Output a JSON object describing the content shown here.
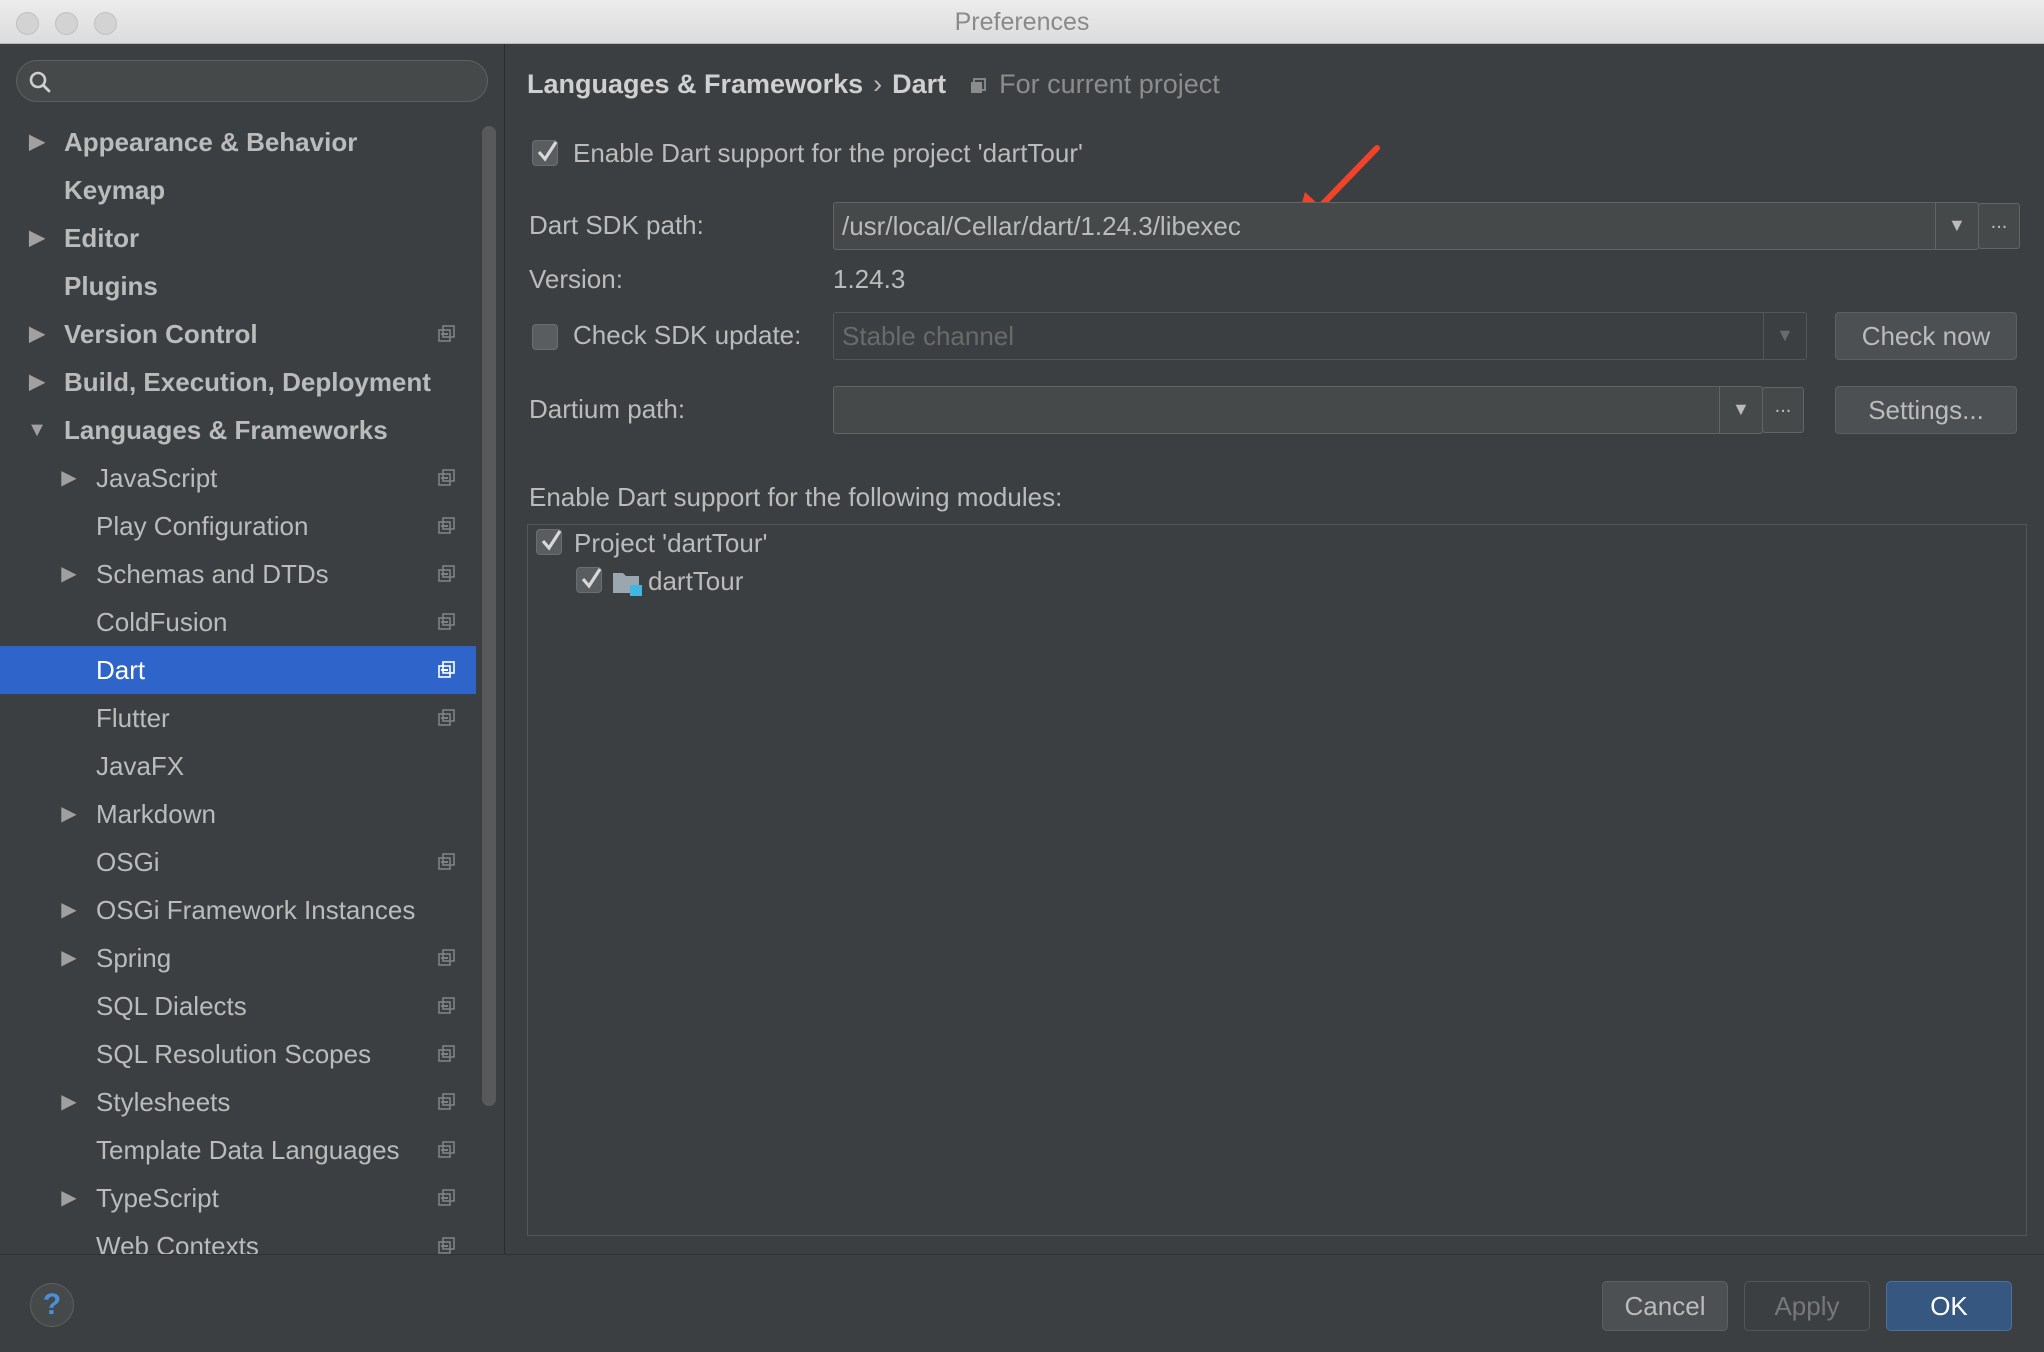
{
  "window": {
    "title": "Preferences"
  },
  "search": {
    "placeholder": ""
  },
  "sidebar": {
    "items": [
      {
        "label": "Appearance & Behavior",
        "bold": true,
        "level": 0,
        "arrow": "right",
        "project": false
      },
      {
        "label": "Keymap",
        "bold": true,
        "level": 0,
        "arrow": "",
        "project": false
      },
      {
        "label": "Editor",
        "bold": true,
        "level": 0,
        "arrow": "right",
        "project": false
      },
      {
        "label": "Plugins",
        "bold": true,
        "level": 0,
        "arrow": "",
        "project": false
      },
      {
        "label": "Version Control",
        "bold": true,
        "level": 0,
        "arrow": "right",
        "project": true
      },
      {
        "label": "Build, Execution, Deployment",
        "bold": true,
        "level": 0,
        "arrow": "right",
        "project": false
      },
      {
        "label": "Languages & Frameworks",
        "bold": true,
        "level": 0,
        "arrow": "down",
        "project": false
      },
      {
        "label": "JavaScript",
        "bold": false,
        "level": 1,
        "arrow": "right",
        "project": true
      },
      {
        "label": "Play Configuration",
        "bold": false,
        "level": 1,
        "arrow": "",
        "project": true
      },
      {
        "label": "Schemas and DTDs",
        "bold": false,
        "level": 1,
        "arrow": "right",
        "project": true
      },
      {
        "label": "ColdFusion",
        "bold": false,
        "level": 1,
        "arrow": "",
        "project": true
      },
      {
        "label": "Dart",
        "bold": false,
        "level": 1,
        "arrow": "",
        "project": true,
        "selected": true
      },
      {
        "label": "Flutter",
        "bold": false,
        "level": 1,
        "arrow": "",
        "project": true
      },
      {
        "label": "JavaFX",
        "bold": false,
        "level": 1,
        "arrow": "",
        "project": false
      },
      {
        "label": "Markdown",
        "bold": false,
        "level": 1,
        "arrow": "right",
        "project": false
      },
      {
        "label": "OSGi",
        "bold": false,
        "level": 1,
        "arrow": "",
        "project": true
      },
      {
        "label": "OSGi Framework Instances",
        "bold": false,
        "level": 1,
        "arrow": "right",
        "project": false
      },
      {
        "label": "Spring",
        "bold": false,
        "level": 1,
        "arrow": "right",
        "project": true
      },
      {
        "label": "SQL Dialects",
        "bold": false,
        "level": 1,
        "arrow": "",
        "project": true
      },
      {
        "label": "SQL Resolution Scopes",
        "bold": false,
        "level": 1,
        "arrow": "",
        "project": true
      },
      {
        "label": "Stylesheets",
        "bold": false,
        "level": 1,
        "arrow": "right",
        "project": true
      },
      {
        "label": "Template Data Languages",
        "bold": false,
        "level": 1,
        "arrow": "",
        "project": true
      },
      {
        "label": "TypeScript",
        "bold": false,
        "level": 1,
        "arrow": "right",
        "project": true
      },
      {
        "label": "Web Contexts",
        "bold": false,
        "level": 1,
        "arrow": "",
        "project": true
      }
    ]
  },
  "breadcrumb": {
    "parent": "Languages & Frameworks",
    "current": "Dart",
    "scope": "For current project"
  },
  "dart": {
    "enable_label": "Enable Dart support for the project 'dartTour'",
    "enable_checked": true,
    "sdk_label": "Dart SDK path:",
    "sdk_value": "/usr/local/Cellar/dart/1.24.3/libexec",
    "version_label": "Version:",
    "version_value": "1.24.3",
    "check_update_label": "Check SDK update:",
    "check_update_checked": false,
    "channel_value": "Stable channel",
    "check_now_label": "Check now",
    "dartium_label": "Dartium path:",
    "dartium_value": "",
    "settings_label": "Settings...",
    "modules_label": "Enable Dart support for the following modules:",
    "modules": [
      {
        "label": "Project 'dartTour'",
        "checked": true,
        "level": 0,
        "folder": false
      },
      {
        "label": "dartTour",
        "checked": true,
        "level": 1,
        "folder": true
      }
    ],
    "ellipsis": "..."
  },
  "footer": {
    "help": "?",
    "cancel": "Cancel",
    "apply": "Apply",
    "ok": "OK"
  },
  "colors": {
    "accent": "#2f65ca",
    "ok_button": "#365880",
    "annotation_arrow": "#f0432a"
  }
}
